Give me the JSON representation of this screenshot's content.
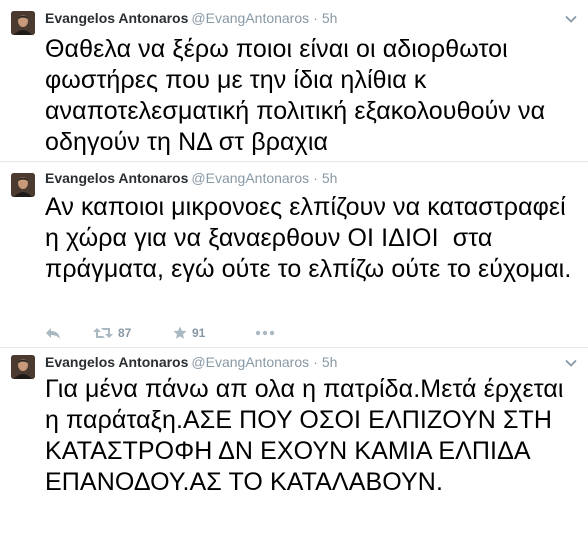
{
  "tweets": [
    {
      "name": "Evangelos Antonaros",
      "handle": "@EvangAntonaros",
      "separator": "·",
      "time": "5h",
      "text": "Θαθελα να ξέρω ποιοι είναι οι αδιορθωτοι φωστήρες που με την ίδια ηλίθια κ αναποτελεσματική πολιτική εξακολουθούν να οδηγούν τη ΝΔ στ βραχια"
    },
    {
      "name": "Evangelos Antonaros",
      "handle": "@EvangAntonaros",
      "separator": "·",
      "time": "5h",
      "text": "Αν καποιοι μικρονοες ελπίζουν να καταστραφεί η χώρα για να ξαναερθουν ΟΙ ΙΔΙΟΙ  στα πράγματα, εγώ ούτε το ελπίζω ούτε το εύχομαι.",
      "retweets": "87",
      "favorites": "91"
    },
    {
      "name": "Evangelos Antonaros",
      "handle": "@EvangAntonaros",
      "separator": "·",
      "time": "5h",
      "text": "Για μένα πάνω απ ολα η πατρίδα.Μετά έρχεται η παράταξη.ΑΣΕ ΠΟΥ ΟΣΟΙ ΕΛΠΙΖΟΥΝ ΣΤΗ ΚΑΤΑΣΤΡΟΦΗ ΔΝ ΕΧΟΥΝ ΚΑΜΙΑ ΕΛΠΙΔΑ ΕΠΑΝΟΔΟΥ.ΑΣ ΤΟ ΚΑΤΑΛΑΒΟΥΝ."
    }
  ],
  "icons": {
    "chevron": "chevron-down-icon",
    "reply": "reply-icon",
    "retweet": "retweet-icon",
    "favorite": "star-icon",
    "more": "more-icon"
  },
  "colors": {
    "meta": "#8899a6",
    "text": "#000000",
    "name": "#292f33",
    "divider": "#e1e8ed"
  }
}
